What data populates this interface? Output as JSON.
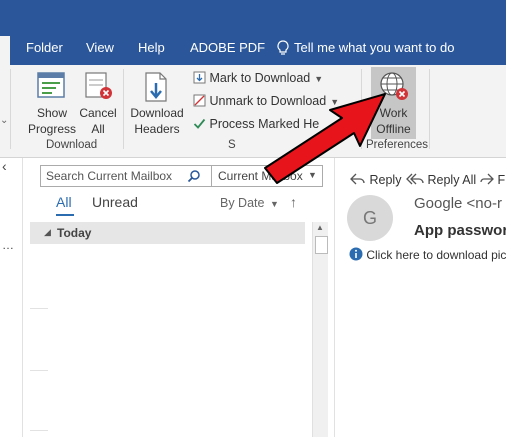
{
  "tabs": {
    "folder": "Folder",
    "view": "View",
    "help": "Help",
    "adobe_pdf": "ADOBE PDF",
    "tell_me": "Tell me what you want to do"
  },
  "ribbon": {
    "show_progress": [
      "Show",
      "Progress"
    ],
    "cancel_all": [
      "Cancel",
      "All"
    ],
    "download_headers": [
      "Download",
      "Headers"
    ],
    "mark_to_download": "Mark to Download",
    "unmark_to_download": "Unmark to Download",
    "process_marked": "Process Marked He",
    "work_offline": [
      "Work",
      "Offline"
    ],
    "group_download": "Download",
    "group_server": "S",
    "group_preferences": "Preferences"
  },
  "mail_list": {
    "search_placeholder": "Search Current Mailbox",
    "scope": "Current Mailbox",
    "filter_all": "All",
    "filter_unread": "Unread",
    "sort": "By Date",
    "group_today": "Today"
  },
  "reading": {
    "reply": "Reply",
    "reply_all": "Reply All",
    "forward": "F",
    "avatar_letter": "G",
    "sender": "Google <no-r",
    "subject": "App passwor",
    "info": "Click here to download pic"
  },
  "colors": {
    "accent": "#2b579a",
    "ribbon": "#f3f3f3",
    "arrow": "#e8141b",
    "selected_tab": "#0072c6"
  }
}
